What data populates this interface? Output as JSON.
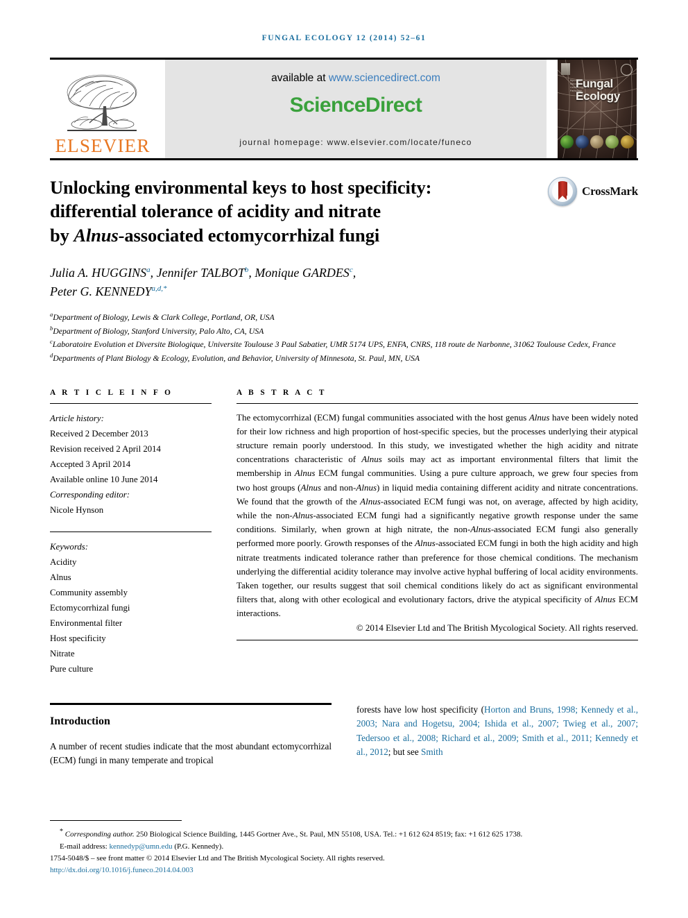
{
  "running_head": "Fungal Ecology 12 (2014) 52–61",
  "masthead": {
    "publisher_name": "ELSEVIER",
    "available_label": "available at",
    "available_url": "www.sciencedirect.com",
    "sciencedirect_logo_science": "Science",
    "sciencedirect_logo_direct": "Direct",
    "homepage_line": "journal homepage: www.elsevier.com/locate/funeco",
    "cover_title_line1": "Fungal",
    "cover_title_line2": "Ecology",
    "cover_sidetext": "Mycology Mycorrhiza Lichenology Pathology"
  },
  "crossmark": {
    "label": "CrossMark"
  },
  "article": {
    "title_line1": "Unlocking environmental keys to host specificity:",
    "title_line2": "differential tolerance of acidity and nitrate",
    "title_line3_pre": "by ",
    "title_line3_italic": "Alnus",
    "title_line3_post": "-associated ectomycorrhizal fungi",
    "authors": [
      {
        "name": "Julia A. HUGGINS",
        "sup": "a",
        "sep": ", "
      },
      {
        "name": "Jennifer TALBOT",
        "sup": "b",
        "sep": ", "
      },
      {
        "name": "Monique GARDES",
        "sup": "c",
        "sep": ","
      },
      {
        "name": "Peter G. KENNEDY",
        "sup": "a,d,*",
        "sep": ""
      }
    ],
    "affiliations": [
      {
        "sup": "a",
        "text": "Department of Biology, Lewis & Clark College, Portland, OR, USA"
      },
      {
        "sup": "b",
        "text": "Department of Biology, Stanford University, Palo Alto, CA, USA"
      },
      {
        "sup": "c",
        "text": "Laboratoire Evolution et Diversite Biologique, Universite Toulouse 3 Paul Sabatier, UMR 5174 UPS, ENFA, CNRS, 118 route de Narbonne, 31062 Toulouse Cedex, France"
      },
      {
        "sup": "d",
        "text": "Departments of Plant Biology & Ecology, Evolution, and Behavior, University of Minnesota, St. Paul, MN, USA"
      }
    ]
  },
  "article_info": {
    "heading": "A R T I C L E   I N F O",
    "history_label": "Article history:",
    "history": [
      "Received 2 December 2013",
      "Revision received 2 April 2014",
      "Accepted 3 April 2014",
      "Available online 10 June 2014"
    ],
    "corresponding_editor_label": "Corresponding editor:",
    "corresponding_editor_name": "Nicole Hynson",
    "keywords_label": "Keywords:",
    "keywords": [
      "Acidity",
      "Alnus",
      "Community assembly",
      "Ectomycorrhizal fungi",
      "Environmental filter",
      "Host specificity",
      "Nitrate",
      "Pure culture"
    ]
  },
  "abstract": {
    "heading": "A B S T R A C T",
    "paragraph": "The ectomycorrhizal (ECM) fungal communities associated with the host genus Alnus have been widely noted for their low richness and high proportion of host-specific species, but the processes underlying their atypical structure remain poorly understood. In this study, we investigated whether the high acidity and nitrate concentrations characteristic of Alnus soils may act as important environmental filters that limit the membership in Alnus ECM fungal communities. Using a pure culture approach, we grew four species from two host groups (Alnus and non-Alnus) in liquid media containing different acidity and nitrate concentrations. We found that the growth of the Alnus-associated ECM fungi was not, on average, affected by high acidity, while the non-Alnus-associated ECM fungi had a significantly negative growth response under the same conditions. Similarly, when grown at high nitrate, the non-Alnus-associated ECM fungi also generally performed more poorly. Growth responses of the Alnus-associated ECM fungi in both the high acidity and high nitrate treatments indicated tolerance rather than preference for those chemical conditions. The mechanism underlying the differential acidity tolerance may involve active hyphal buffering of local acidity environments. Taken together, our results suggest that soil chemical conditions likely do act as significant environmental filters that, along with other ecological and evolutionary factors, drive the atypical specificity of Alnus ECM interactions.",
    "copyright": "© 2014 Elsevier Ltd and The British Mycological Society. All rights reserved."
  },
  "introduction": {
    "heading": "Introduction",
    "left_text": "A number of recent studies indicate that the most abundant ectomycorrhizal (ECM) fungi in many temperate and tropical",
    "right_pre": "forests have low host specificity (",
    "right_refs": "Horton and Bruns, 1998; Kennedy et al., 2003; Nara and Hogetsu, 2004; Ishida et al., 2007; Twieg et al., 2007; Tedersoo et al., 2008; Richard et al., 2009; Smith et al., 2011; Kennedy et al., 2012",
    "right_mid": "; but see ",
    "right_tail": "Smith"
  },
  "footnotes": {
    "corresponding": "Corresponding author. 250 Biological Science Building, 1445 Gortner Ave., St. Paul, MN 55108, USA. Tel.: +1 612 624 8519; fax: +1 612 625 1738.",
    "corresponding_marker": "*",
    "corresponding_italic_label": "Corresponding author.",
    "email_label": "E-mail address:",
    "email_address": "kennedyp@umn.edu",
    "email_owner": "(P.G. Kennedy).",
    "issn_line": "1754-5048/$ – see front matter © 2014 Elsevier Ltd and The British Mycological Society. All rights reserved.",
    "doi": "http://dx.doi.org/10.1016/j.funeco.2014.04.003"
  },
  "colors": {
    "link_blue": "#1a6e9e",
    "sciencedirect_green": "#3aa13c",
    "elsevier_orange": "#E87722",
    "sd_link_blue": "#3a7dbd"
  }
}
